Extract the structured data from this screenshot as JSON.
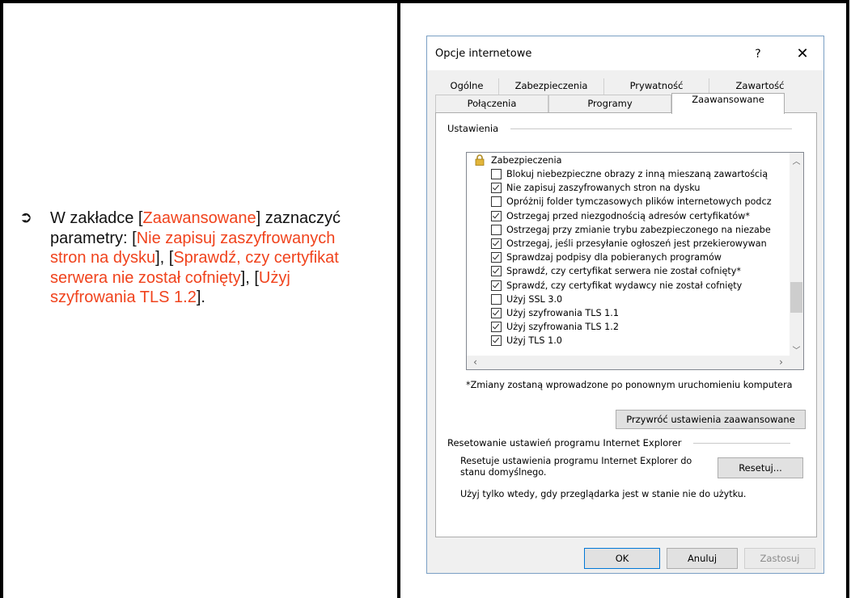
{
  "instruction": {
    "bullet": "➲",
    "t1": "W zakładce [",
    "h1": "Zaawansowane",
    "t2": "] zaznaczyć parametry: [",
    "h2": "Nie zapisuj zaszyfrowanych stron na dysku",
    "t3": "], [",
    "h3": "Sprawdź, czy certyfikat serwera nie został cofnięty",
    "t4": "], [",
    "h4": "Użyj szyfrowania TLS 1.2",
    "t5": "]."
  },
  "dialog": {
    "title": "Opcje internetowe",
    "help": "?",
    "close": "✕",
    "tabs_row1": [
      "Ogólne",
      "Zabezpieczenia",
      "Prywatność",
      "Zawartość"
    ],
    "tabs_row2": [
      "Połączenia",
      "Programy",
      "Zaawansowane"
    ],
    "settings_label": "Ustawienia",
    "list": {
      "category": "Zabezpieczenia",
      "items": [
        {
          "label": "Blokuj niebezpieczne obrazy z inną mieszaną zawartością",
          "checked": false
        },
        {
          "label": "Nie zapisuj zaszyfrowanych stron na dysku",
          "checked": true
        },
        {
          "label": "Opróżnij folder tymczasowych plików internetowych podcz",
          "checked": false
        },
        {
          "label": "Ostrzegaj przed niezgodnością adresów certyfikatów*",
          "checked": true
        },
        {
          "label": "Ostrzegaj przy zmianie trybu zabezpieczonego na niezabe",
          "checked": false
        },
        {
          "label": "Ostrzegaj, jeśli przesyłanie ogłoszeń jest przekierowywan",
          "checked": true
        },
        {
          "label": "Sprawdzaj podpisy dla pobieranych programów",
          "checked": true
        },
        {
          "label": "Sprawdź, czy certyfikat serwera nie został cofnięty*",
          "checked": true
        },
        {
          "label": "Sprawdź, czy certyfikat wydawcy nie został cofnięty",
          "checked": true
        },
        {
          "label": "Użyj SSL 3.0",
          "checked": false
        },
        {
          "label": "Użyj szyfrowania TLS 1.1",
          "checked": true
        },
        {
          "label": "Użyj szyfrowania TLS 1.2",
          "checked": true
        },
        {
          "label": "Użyj TLS 1.0",
          "checked": true
        }
      ]
    },
    "note": "*Zmiany zostaną wprowadzone po ponownym uruchomieniu komputera",
    "restore_button": "Przywróć ustawienia zaawansowane",
    "reset_group_label": "Resetowanie ustawień programu Internet Explorer",
    "reset_desc": "Resetuje ustawienia programu Internet Explorer do stanu domyślnego.",
    "reset_button": "Resetuj...",
    "reset_warning": "Użyj tylko wtedy, gdy przeglądarka jest w stanie nie do użytku.",
    "ok": "OK",
    "cancel": "Anuluj",
    "apply": "Zastosuj"
  }
}
